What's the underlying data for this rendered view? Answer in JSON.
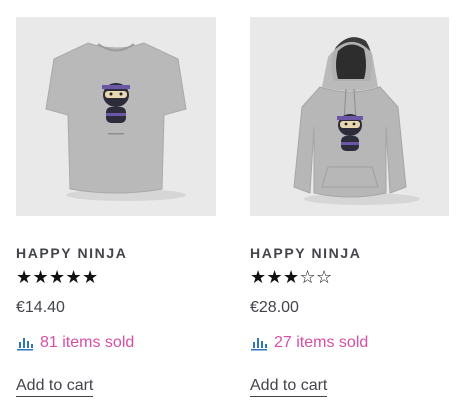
{
  "products": [
    {
      "image_alt": "Happy Ninja t-shirt",
      "title": "HAPPY NINJA",
      "rating": 5,
      "rating_max": 5,
      "price": "€14.40",
      "sold": "81 items sold",
      "cart_label": "Add to cart"
    },
    {
      "image_alt": "Happy Ninja hoodie",
      "title": "HAPPY NINJA",
      "rating": 3,
      "rating_max": 5,
      "price": "€28.00",
      "sold": "27 items sold",
      "cart_label": "Add to cart"
    }
  ],
  "colors": {
    "text": "#43454b",
    "accent_pink": "#d84ea6",
    "chart_icon_blue": "#2f75b8",
    "image_bg": "#e9e9e9",
    "star": "#111111"
  },
  "icons": {
    "sold": "bar-chart-icon",
    "star_filled": "star-filled-icon",
    "star_empty": "star-empty-icon"
  }
}
